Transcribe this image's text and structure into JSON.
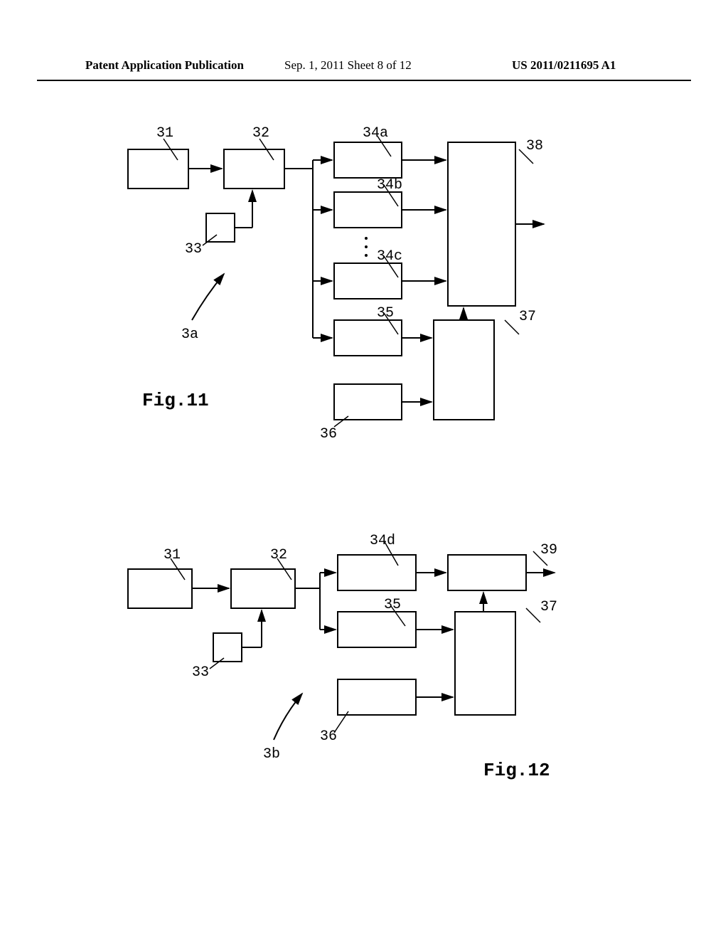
{
  "header": {
    "left": "Patent Application Publication",
    "mid": "Sep. 1, 2011   Sheet 8 of 12",
    "right": "US 2011/0211695 A1"
  },
  "fig11": {
    "caption": "Fig.11",
    "labels": {
      "n31": "31",
      "n32": "32",
      "n33": "33",
      "n34a": "34a",
      "n34b": "34b",
      "n34c": "34c",
      "n35": "35",
      "n36": "36",
      "n37": "37",
      "n38": "38",
      "n3a": "3a"
    }
  },
  "fig12": {
    "caption": "Fig.12",
    "labels": {
      "n31": "31",
      "n32": "32",
      "n33": "33",
      "n34d": "34d",
      "n35": "35",
      "n36": "36",
      "n37": "37",
      "n39": "39",
      "n3b": "3b"
    }
  }
}
